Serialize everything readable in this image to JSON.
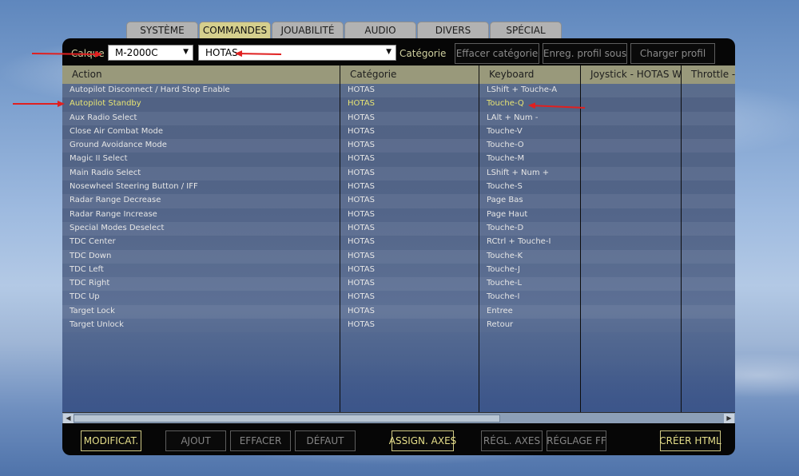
{
  "tabs": [
    "SYSTÈME",
    "COMMANDES",
    "JOUABILITÉ",
    "AUDIO",
    "DIVERS",
    "SPÉCIAL"
  ],
  "active_tab": "COMMANDES",
  "toolbar": {
    "calque_label": "Calque",
    "aircraft_value": "M-2000C",
    "category_filter_value": "HOTAS",
    "categorie_label": "Catégorie",
    "clear_category_button": "Effacer catégorie",
    "save_profile_button": "Enreg. profil sous",
    "load_profile_button": "Charger profil"
  },
  "table": {
    "columns": [
      "Action",
      "Catégorie",
      "Keyboard",
      "Joystick - HOTAS Wa",
      "Throttle - "
    ],
    "rows": [
      [
        "Autopilot Disconnect / Hard Stop Enable",
        "HOTAS",
        "LShift + Touche-A"
      ],
      [
        "Autopilot Standby",
        "HOTAS",
        "Touche-Q"
      ],
      [
        "Aux Radio Select",
        "HOTAS",
        "LAlt + Num -"
      ],
      [
        "Close Air Combat Mode",
        "HOTAS",
        "Touche-V"
      ],
      [
        "Ground Avoidance Mode",
        "HOTAS",
        "Touche-O"
      ],
      [
        "Magic II Select",
        "HOTAS",
        "Touche-M"
      ],
      [
        "Main Radio Select",
        "HOTAS",
        "LShift + Num +"
      ],
      [
        "Nosewheel Steering Button / IFF",
        "HOTAS",
        "Touche-S"
      ],
      [
        "Radar Range Decrease",
        "HOTAS",
        "Page Bas"
      ],
      [
        "Radar Range Increase",
        "HOTAS",
        "Page Haut"
      ],
      [
        "Special Modes Deselect",
        "HOTAS",
        "Touche-D"
      ],
      [
        "TDC Center",
        "HOTAS",
        "RCtrl + Touche-I"
      ],
      [
        "TDC Down",
        "HOTAS",
        "Touche-K"
      ],
      [
        "TDC Left",
        "HOTAS",
        "Touche-J"
      ],
      [
        "TDC Right",
        "HOTAS",
        "Touche-L"
      ],
      [
        "TDC Up",
        "HOTAS",
        "Touche-I"
      ],
      [
        "Target Lock",
        "HOTAS",
        "Entree"
      ],
      [
        "Target Unlock",
        "HOTAS",
        "Retour"
      ]
    ],
    "selected_row": 1
  },
  "bottom_buttons": {
    "modify": "MODIFICAT.",
    "add": "AJOUT",
    "erase": "EFFACER",
    "default": "DÉFAUT",
    "assign_axes": "ASSIGN. AXES",
    "axis_tune": "RÉGL. AXES",
    "ff_tune": "RÉGLAGE FF",
    "create_html": "CRÉER HTML"
  },
  "annotation_color": "#e02020"
}
